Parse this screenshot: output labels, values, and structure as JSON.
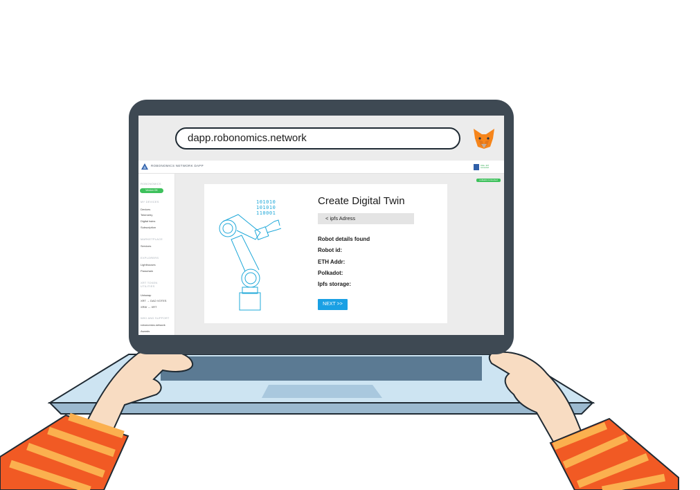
{
  "browser": {
    "url": "dapp.robonomics.network",
    "extension_icon": "metamask-fox-icon"
  },
  "app": {
    "title": "ROBONOMICS NETWORK DAPP",
    "wallet_label": "0x6a...9d7 connected",
    "connection_badge": "polkadot connected",
    "sidebar": {
      "sections": [
        {
          "heading": "ROBONOMICS",
          "items": []
        },
        {
          "heading": "MY DEVICES",
          "items": [
            "Devices",
            "Telemetry",
            "Digital twins",
            "Subscription"
          ]
        },
        {
          "heading": "MARKETPLACE",
          "items": [
            "Services"
          ]
        },
        {
          "heading": "EXPLORERS",
          "items": [
            "Lighthouses",
            "Parachain"
          ]
        },
        {
          "heading": "XRT TOKEN UTILITIES",
          "items": [
            "Uniswap",
            "XRT → DAO VOTES",
            "XRW ↔ XRT"
          ]
        },
        {
          "heading": "WIKI AND SUPPORT",
          "items": [
            "robonomics.network",
            "Awards"
          ]
        }
      ],
      "status_button": "Version OK"
    }
  },
  "card": {
    "binary_lines": [
      "101010",
      "101010",
      "110001"
    ],
    "title": "Create Digital Twin",
    "ipfs_input": "< ipfs Adress",
    "details": [
      "Robot details found",
      "Robot id:",
      "ETH Addr:",
      "Polkadot:",
      "Ipfs storage:"
    ],
    "next_button": "NEXT >>"
  },
  "colors": {
    "accent": "#1aa0e4",
    "status_green": "#3ec15c",
    "robot_line": "#1ea8d9",
    "sleeve_orange": "#f15a24",
    "sleeve_stripe": "#fbb04f"
  }
}
